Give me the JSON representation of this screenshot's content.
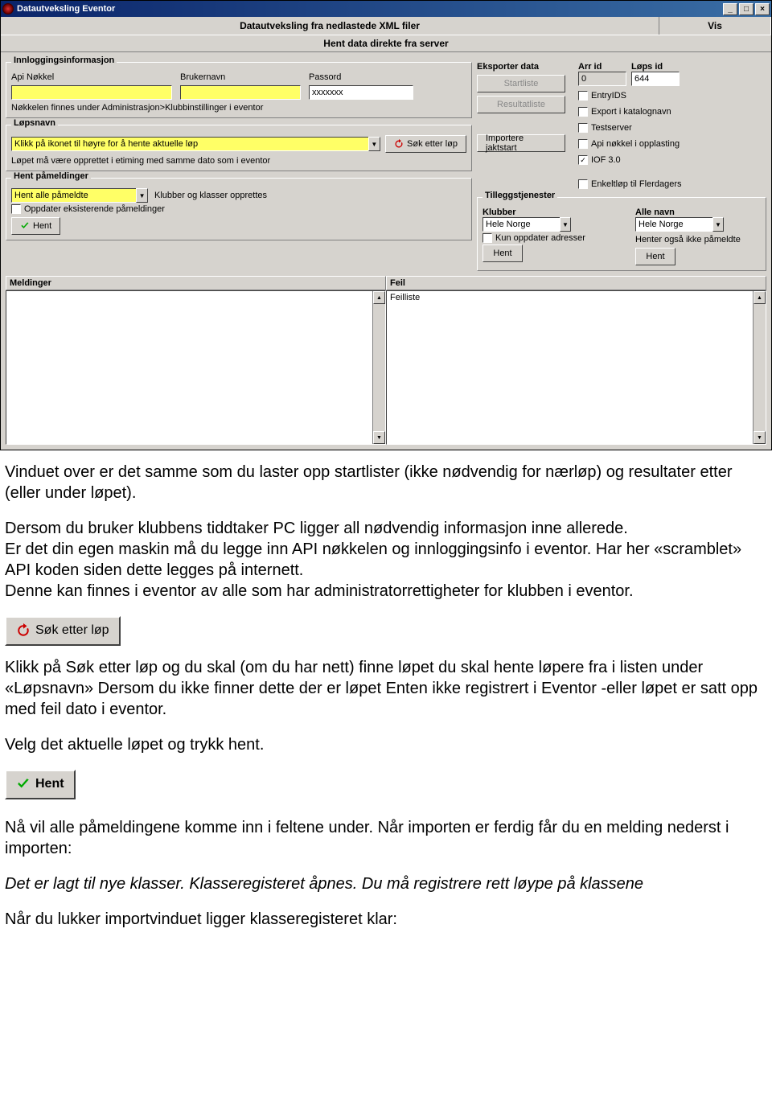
{
  "window": {
    "title": "Datautveksling Eventor",
    "menubar": {
      "left": "Datautveksling fra nedlastede XML filer",
      "right": "Vis"
    },
    "section": "Hent data direkte fra server"
  },
  "login": {
    "legend": "Innloggingsinformasjon",
    "api_label": "Api Nøkkel",
    "api_value": "",
    "user_label": "Brukernavn",
    "user_value": "",
    "pass_label": "Passord",
    "pass_value": "xxxxxxx",
    "note": "Nøkkelen finnes under Administrasjon>Klubbinstillinger i eventor"
  },
  "lopsnavn": {
    "legend": "Løpsnavn",
    "value": "Klikk på ikonet til høyre for å hente aktuelle løp",
    "sok_label": "Søk etter løp",
    "note": "Løpet må være opprettet i etiming med samme dato som i eventor"
  },
  "pameld": {
    "legend": "Hent påmeldinger",
    "dropdown_value": "Hent alle påmeldte",
    "info": "Klubber og klasser opprettes",
    "update_label": "Oppdater eksisterende påmeldinger",
    "hent_label": "Hent"
  },
  "eksport": {
    "label": "Eksporter data",
    "startliste": "Startliste",
    "resultatliste": "Resultatliste",
    "importer": "Importere jaktstart"
  },
  "ids": {
    "arr_label": "Arr id",
    "arr_value": "0",
    "lops_label": "Løps id",
    "lops_value": "644"
  },
  "flags": {
    "entryids": "EntryIDS",
    "export_katalog": "Export i katalognavn",
    "testserver": "Testserver",
    "api_opplasting": "Api nøkkel i opplasting",
    "iof30": "IOF 3.0",
    "enkeltlop": "Enkeltløp til Flerdagers"
  },
  "tillegg": {
    "legend": "Tilleggstjenester",
    "klubber_label": "Klubber",
    "klubber_value": "Hele Norge",
    "kun_adresser": "Kun oppdater adresser",
    "allenavn_label": "Alle navn",
    "allenavn_value": "Hele Norge",
    "allenavn_note": "Henter også ikke påmeldte",
    "hent": "Hent"
  },
  "panes": {
    "meldinger": "Meldinger",
    "feil": "Feil",
    "feilliste_header": "Feilliste"
  },
  "doc": {
    "p1": "Vinduet over er det samme som du laster opp startlister (ikke nødvendig for nærløp) og resultater etter (eller under løpet).",
    "p2": "Dersom du bruker klubbens tiddtaker PC ligger all nødvendig informasjon inne allerede.",
    "p3": "Er det din egen maskin må du legge inn API nøkkelen og innloggingsinfo i eventor. Har her «scramblet» API koden siden dette legges på internett.",
    "p4": "Denne kan finnes i eventor av alle som har administratorrettigheter for klubben i eventor.",
    "sok_btn": "Søk etter løp",
    "p5": "Klikk på Søk etter løp og du skal (om du har nett) finne løpet du skal hente løpere fra i listen under «Løpsnavn» Dersom du ikke finner dette der er løpet Enten ikke registrert i Eventor -eller løpet er satt opp med feil dato i eventor.",
    "p6": "Velg det aktuelle løpet og trykk hent.",
    "hent_btn": "Hent",
    "p7": "Nå vil alle påmeldingene komme inn i feltene under. Når importen er ferdig får du en melding nederst i importen:",
    "p8": "Det er lagt til nye klasser. Klasseregisteret åpnes. Du må registrere rett løype på klassene",
    "p9": "Når du lukker importvinduet ligger klasseregisteret klar:"
  }
}
